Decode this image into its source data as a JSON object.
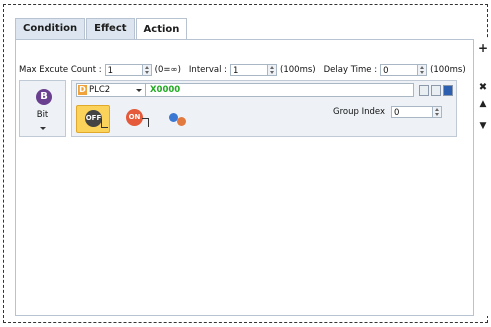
{
  "tabs": [
    {
      "label": "Condition"
    },
    {
      "label": "Effect"
    },
    {
      "label": "Action"
    }
  ],
  "params": {
    "max_count_label": "Max Excute Count :",
    "max_count_value": "1",
    "max_count_hint": "(0=∞)",
    "interval_label": "Interval :",
    "interval_value": "1",
    "interval_unit": "(100ms)",
    "delay_label": "Delay Time :",
    "delay_value": "0",
    "delay_unit": "(100ms)"
  },
  "bit": {
    "letter": "B",
    "label": "Bit"
  },
  "device": {
    "plc_letter": "D",
    "plc": "PLC2",
    "address": "X0000"
  },
  "actions": {
    "off_text": "OFF",
    "on_text": "ON"
  },
  "group": {
    "label": "Group Index",
    "value": "0"
  },
  "side_buttons": {
    "add": "+",
    "delete": "✖",
    "up": "▲",
    "down": "▼"
  },
  "colors": {
    "tab_bg": "#dde6f0",
    "bit_circle": "#6b3f90",
    "plc_badge": "#f0a33a",
    "address_text": "#22aa22",
    "selected_action": "#fbd35a"
  }
}
